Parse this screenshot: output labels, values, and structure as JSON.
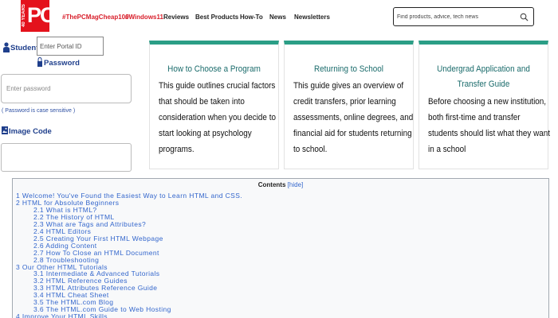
{
  "nav": {
    "logo_years": "40 YEARS",
    "logo_text": "PC",
    "links": [
      {
        "label": "#ThePCMagCheap100",
        "red": true
      },
      {
        "label": "#Windows11",
        "red": true
      },
      {
        "label": "Reviews",
        "red": false
      },
      {
        "label": "Best Products",
        "red": false
      },
      {
        "label": "How-To",
        "red": false
      },
      {
        "label": "News",
        "red": false
      },
      {
        "label": "Newsletters",
        "red": false
      }
    ],
    "search_placeholder": "Find products, advice, tech news"
  },
  "login": {
    "student_id_label": "Student ID",
    "portal_placeholder": "Enter Portal ID",
    "password_label": "Password",
    "password_placeholder": "Enter password",
    "case_hint": "( Password is case sensitive )",
    "image_code_label": "Image Code"
  },
  "cards": [
    {
      "title": "How to Choose a Program",
      "body": "This guide outlines crucial factors that should be taken into consideration when you decide to start looking at psychology programs."
    },
    {
      "title": "Returning to School",
      "body": "This guide gives an overview of credit transfers, prior learning assessments, online degrees, and financial aid for students returning to school."
    },
    {
      "title": "Undergrad Application and Transfer Guide",
      "body": "Before choosing a new institution, both first-time and transfer students should list what they want in a school"
    }
  ],
  "toc": {
    "title": "Contents",
    "hide_label": "hide",
    "items": [
      {
        "text": "1 Welcome! You've Found the Easiest Way to Learn HTML and CSS.",
        "level": 1
      },
      {
        "text": "2 HTML for Absolute Beginners",
        "level": 1
      },
      {
        "text": "2.1 What is HTML?",
        "level": 2
      },
      {
        "text": "2.2 The History of HTML",
        "level": 2
      },
      {
        "text": "2.3 What are Tags and Attributes?",
        "level": 2
      },
      {
        "text": "2.4 HTML Editors",
        "level": 2
      },
      {
        "text": "2.5 Creating Your First HTML Webpage",
        "level": 2
      },
      {
        "text": "2.6 Adding Content",
        "level": 2
      },
      {
        "text": "2.7 How To Close an HTML Document",
        "level": 2
      },
      {
        "text": "2.8 Troubleshooting",
        "level": 2
      },
      {
        "text": "3 Our Other HTML Tutorials",
        "level": 1
      },
      {
        "text": "3.1 Intermediate & Advanced Tutorials",
        "level": 2
      },
      {
        "text": "3.2 HTML Reference Guides",
        "level": 2
      },
      {
        "text": "3.3 HTML Attributes Reference Guide",
        "level": 2
      },
      {
        "text": "3.4 HTML Cheat Sheet",
        "level": 2
      },
      {
        "text": "3.5 The HTML.com Blog",
        "level": 2
      },
      {
        "text": "3.6 The HTML.com Guide to Web Hosting",
        "level": 2
      },
      {
        "text": "4 Improve Your HTML Skills",
        "level": 1
      }
    ]
  }
}
